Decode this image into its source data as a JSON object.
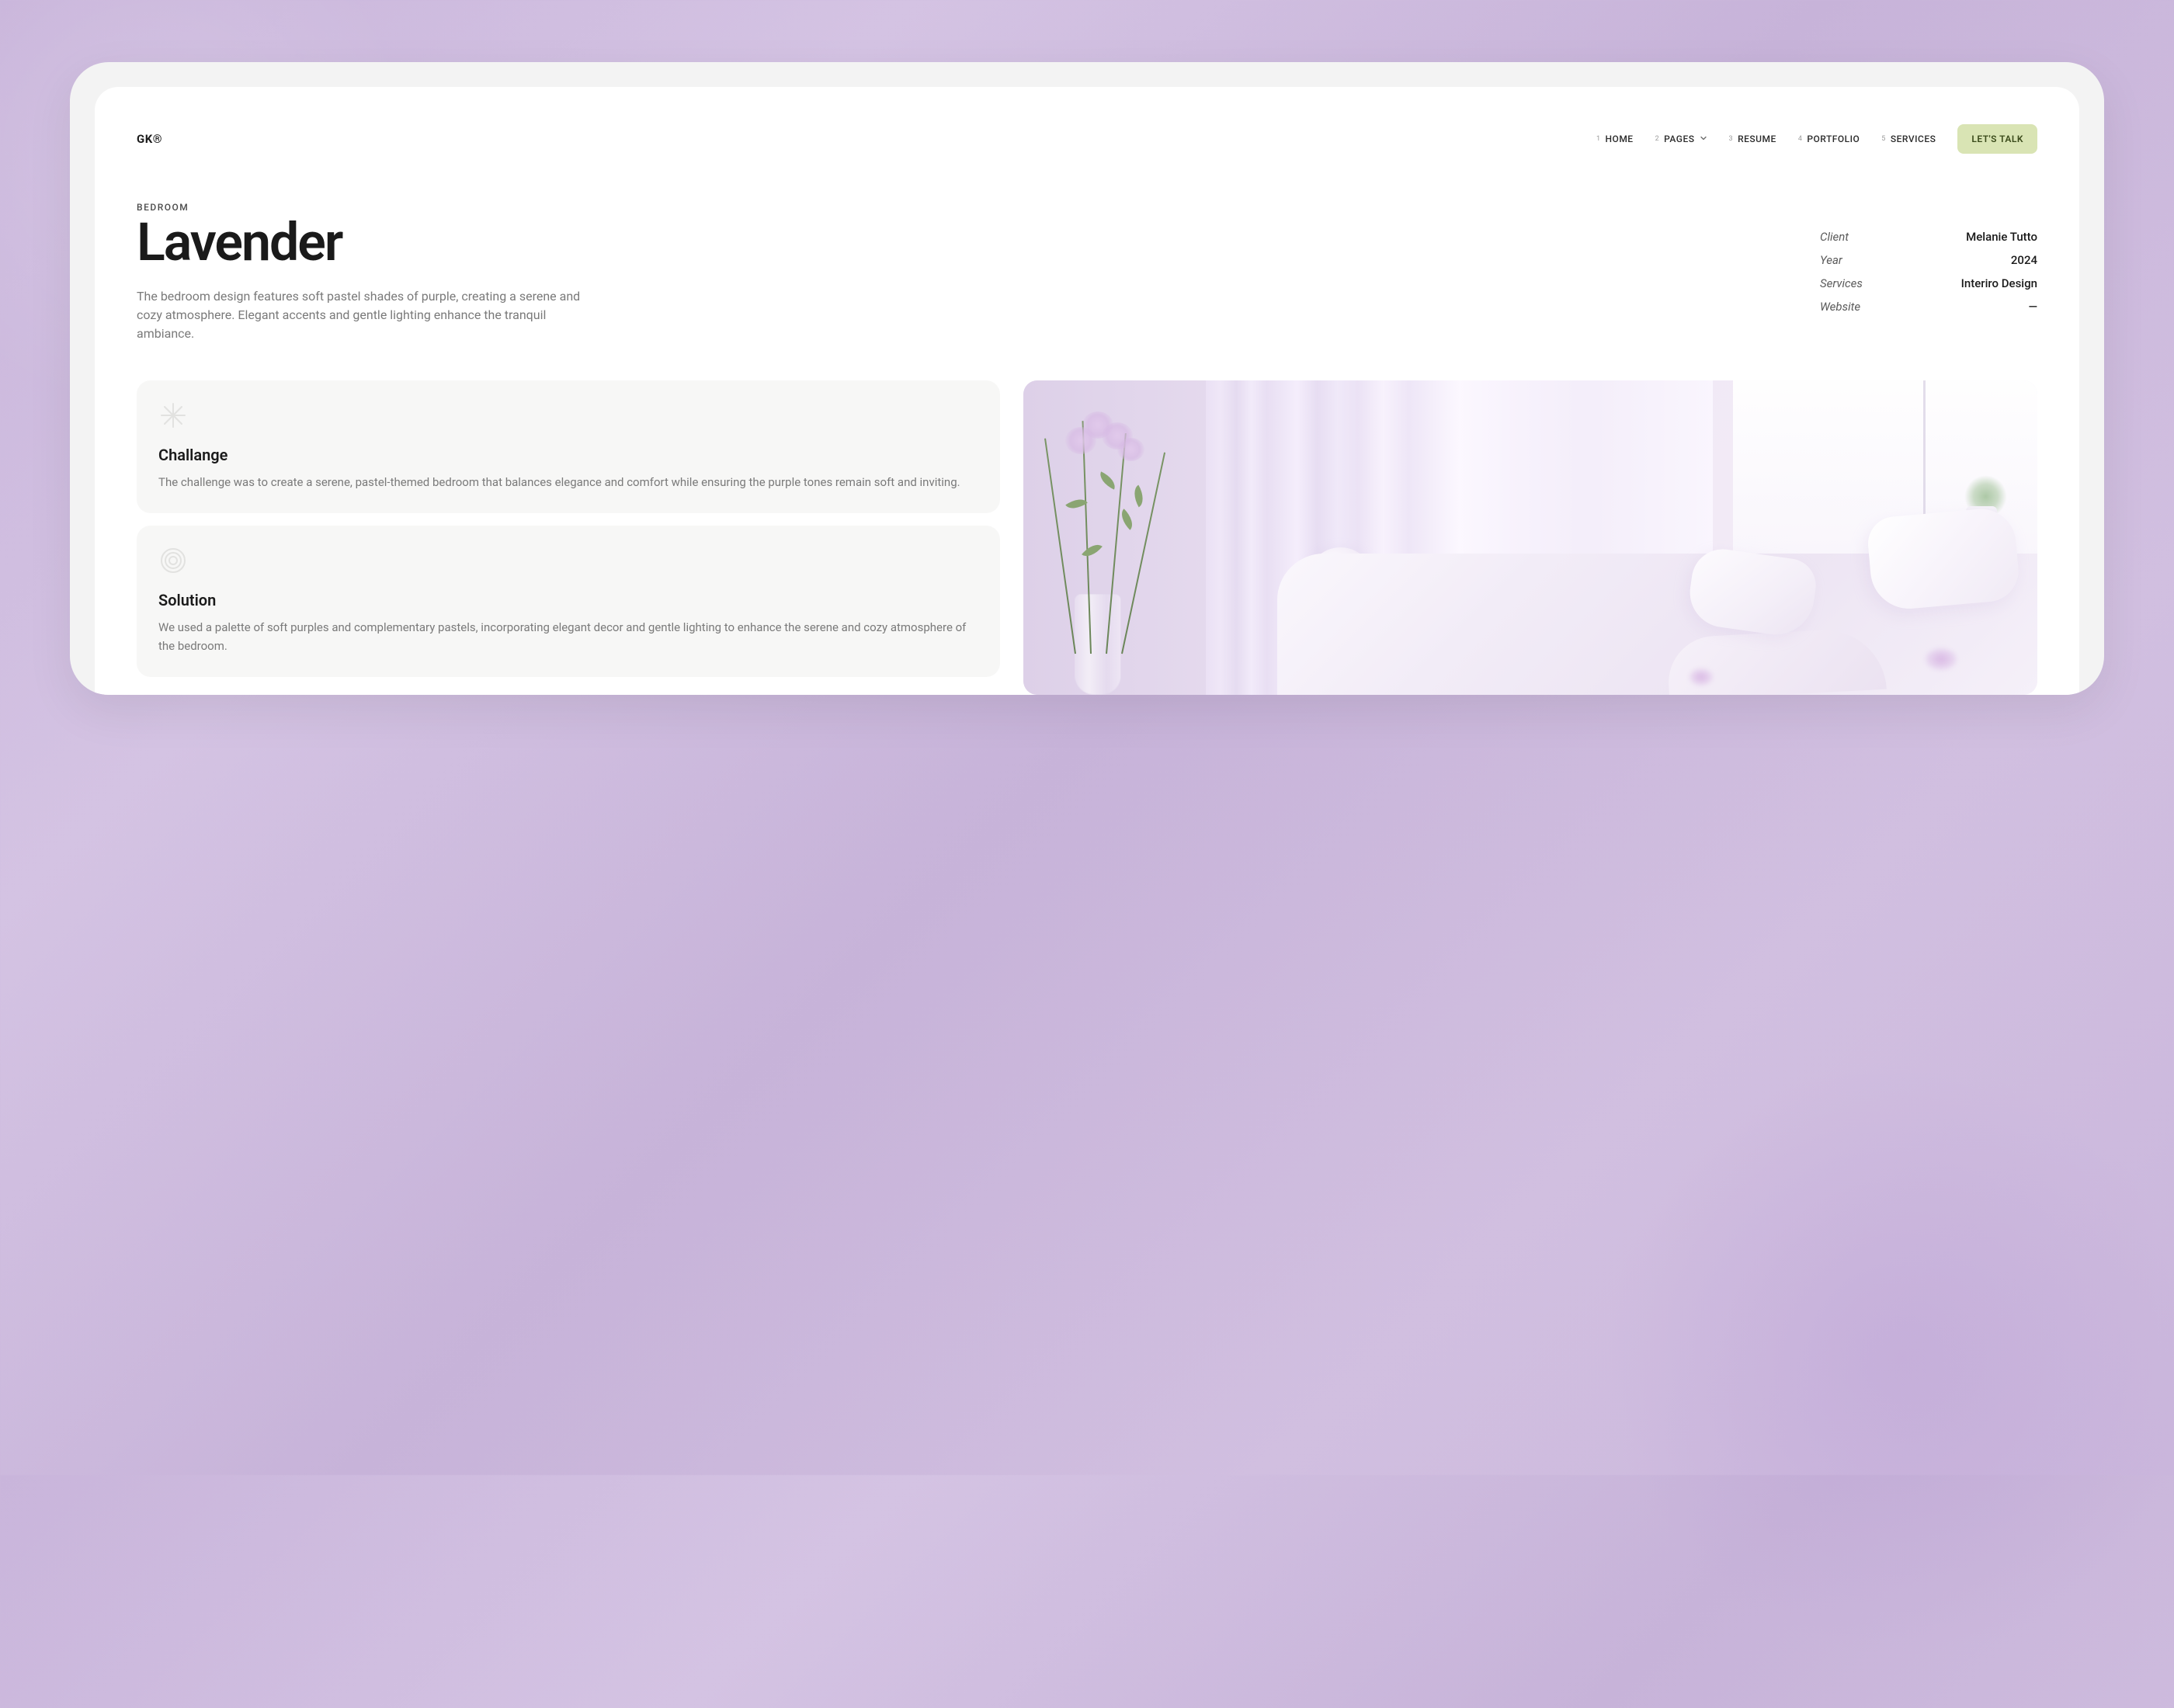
{
  "logo": "GK®",
  "nav": {
    "items": [
      {
        "num": "1",
        "label": "HOME"
      },
      {
        "num": "2",
        "label": "PAGES"
      },
      {
        "num": "3",
        "label": "RESUME"
      },
      {
        "num": "4",
        "label": "PORTFOLIO"
      },
      {
        "num": "5",
        "label": "SERVICES"
      }
    ],
    "cta": "LET'S TALK"
  },
  "hero": {
    "category": "BEDROOM",
    "title": "Lavender",
    "description": "The bedroom design features soft pastel shades of purple, creating a serene and cozy atmosphere. Elegant accents and gentle lighting enhance the tranquil ambiance."
  },
  "meta": [
    {
      "label": "Client",
      "value": "Melanie Tutto"
    },
    {
      "label": "Year",
      "value": "2024"
    },
    {
      "label": "Services",
      "value": "Interiro Design"
    },
    {
      "label": "Website",
      "value": "—"
    }
  ],
  "cards": {
    "challenge": {
      "title": "Challange",
      "body": "The challenge was to create a serene, pastel-themed bedroom that balances elegance and comfort while ensuring the purple tones remain soft and inviting."
    },
    "solution": {
      "title": "Solution",
      "body": "We used a palette of soft purples and complementary pastels, incorporating elegant decor and gentle lighting to enhance the serene and cozy atmosphere of the bedroom."
    }
  }
}
